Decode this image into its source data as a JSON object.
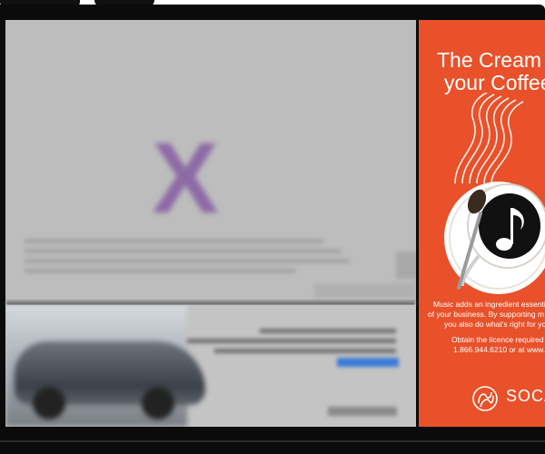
{
  "window": {
    "title": ""
  },
  "overlay": {
    "close_glyph": "X"
  },
  "ad": {
    "title_line1": "The Cream",
    "title_line2": "your Coffee",
    "body_line1": "Music adds an ingredient essential",
    "body_line2": "of your business. By supporting m",
    "body_line3": "you also do what's right for you",
    "cta_line1": "Obtain the licence required b",
    "cta_line2": "1.866.944.6210 or at www.s",
    "brand": "SOCAN",
    "colors": {
      "background": "#e8512a",
      "text": "#ffffff"
    }
  },
  "icons": [
    "close-icon",
    "steam-icon",
    "coffee-cup-icon",
    "music-note-icon",
    "spoon-icon",
    "socan-logo-icon"
  ]
}
